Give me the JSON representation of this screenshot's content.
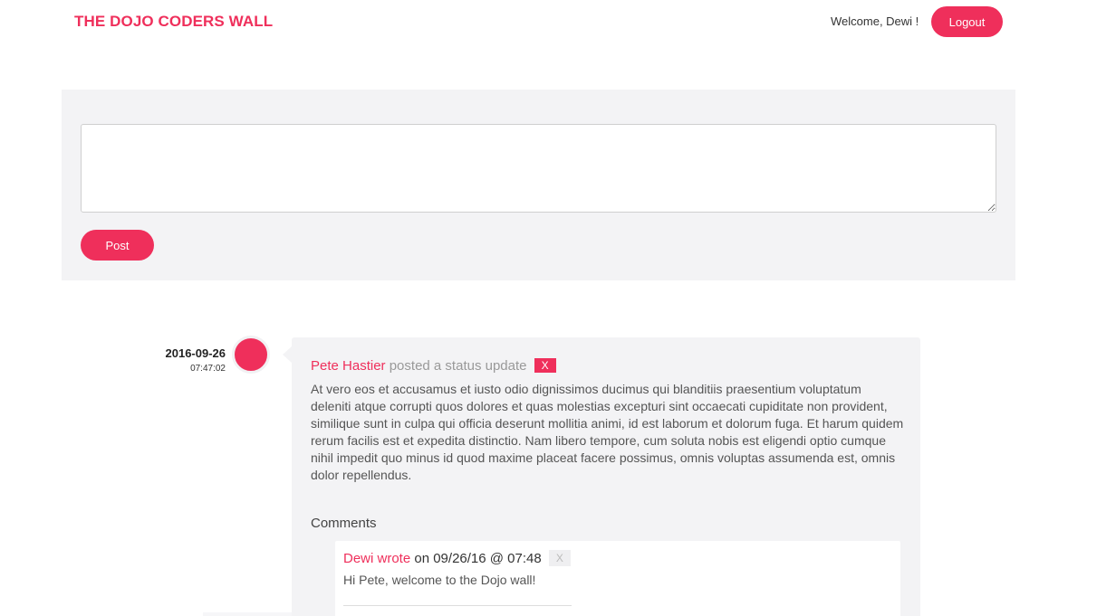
{
  "header": {
    "brand": "THE DOJO CODERS WALL",
    "welcome": "Welcome, Dewi !",
    "logout_label": "Logout"
  },
  "composer": {
    "textarea_value": "",
    "post_label": "Post"
  },
  "posts": [
    {
      "date": "2016-09-26",
      "time": "07:47:02",
      "author": "Pete Hastier",
      "action": "posted a status update",
      "delete_label": "X",
      "body": "At vero eos et accusamus et iusto odio dignissimos ducimus qui blanditiis praesentium voluptatum deleniti atque corrupti quos dolores et quas molestias excepturi sint occaecati cupiditate non provident, similique sunt in culpa qui officia deserunt mollitia animi, id est laborum et dolorum fuga. Et harum quidem rerum facilis est et expedita distinctio. Nam libero tempore, cum soluta nobis est eligendi optio cumque nihil impedit quo minus id quod maxime placeat facere possimus, omnis voluptas assumenda est, omnis dolor repellendus.",
      "comments_heading": "Comments",
      "comments": [
        {
          "author": "Dewi wrote",
          "meta": "on 09/26/16 @ 07:48",
          "delete_label": "X",
          "text": "Hi Pete, welcome to the Dojo wall!"
        }
      ]
    }
  ],
  "colors": {
    "accent": "#ef2f5b",
    "panel_bg": "#f3f3f5",
    "muted_text": "#999999"
  }
}
